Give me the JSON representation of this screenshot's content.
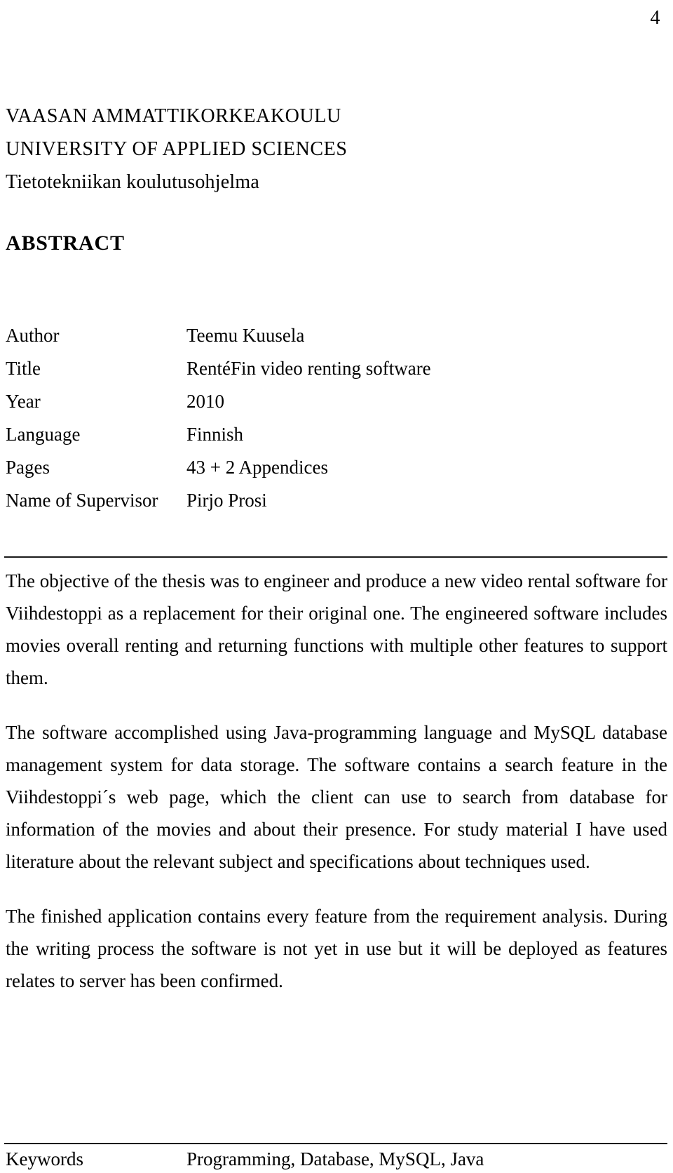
{
  "page": {
    "number": "4"
  },
  "institution": {
    "name_fi": "VAASAN AMMATTIKORKEAKOULU",
    "name_en": "UNIVERSITY OF APPLIED SCIENCES",
    "programme": "Tietotekniikan koulutusohjelma"
  },
  "section": {
    "heading": "ABSTRACT"
  },
  "metadata": {
    "rows": [
      {
        "label": "Author",
        "value": "Teemu Kuusela"
      },
      {
        "label": "Title",
        "value": "RentéFin video renting software"
      },
      {
        "label": "Year",
        "value": "2010"
      },
      {
        "label": "Language",
        "value": "Finnish"
      },
      {
        "label": "Pages",
        "value": "43 + 2 Appendices"
      },
      {
        "label": "Name of Supervisor",
        "value": "Pirjo Prosi"
      }
    ]
  },
  "abstract": {
    "paragraphs": [
      "The objective of the thesis was to engineer and produce a new video rental software for Viihdestoppi as a replacement for their original one. The engineered software includes movies overall renting and returning functions with multiple other features to support them.",
      "The software accomplished using Java-programming language and MySQL database management system for data storage. The software contains a search feature in the Viihdestoppi´s web page, which the client can use to search from database for information of the movies and about their presence. For study material I have used literature about the relevant subject and specifications about techniques used.",
      "The finished application contains every feature from the requirement analysis. During the writing process the software is not yet in use but it will be deployed as features relates to server has been confirmed."
    ]
  },
  "keywords": {
    "label": "Keywords",
    "value": "Programming, Database, MySQL, Java"
  }
}
